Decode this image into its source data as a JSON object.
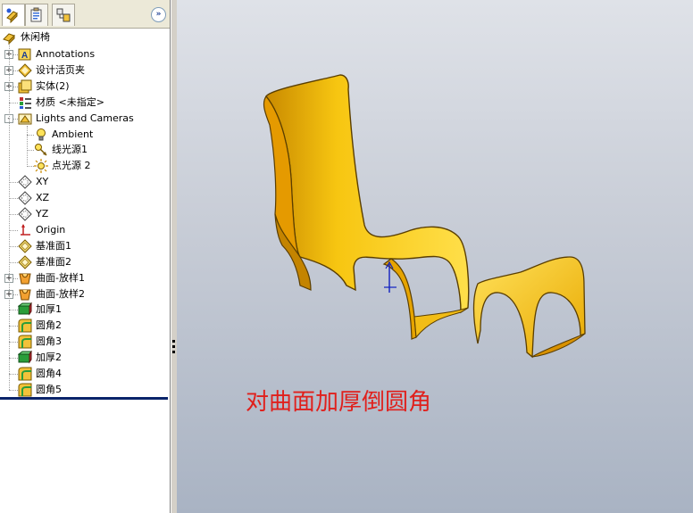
{
  "feature_tree": {
    "tabs": [
      {
        "icon": "feature-manager-icon"
      },
      {
        "icon": "property-manager-icon"
      },
      {
        "icon": "configuration-manager-icon"
      }
    ],
    "expand_symbol": "»",
    "root": {
      "label": "休闲椅",
      "icon": "part-icon"
    },
    "items": [
      {
        "label": "Annotations",
        "icon": "annotations-icon",
        "expander": "+"
      },
      {
        "label": "设计活页夹",
        "icon": "design-binder-icon",
        "expander": "+"
      },
      {
        "label": "实体(2)",
        "icon": "solid-bodies-icon",
        "expander": "+"
      },
      {
        "label": "材质 <未指定>",
        "icon": "material-icon",
        "expander": ""
      },
      {
        "label": "Lights and Cameras",
        "icon": "lights-icon",
        "expander": "-"
      },
      {
        "label": "Ambient",
        "icon": "ambient-light-icon",
        "expander": "",
        "child": true
      },
      {
        "label": "线光源1",
        "icon": "directional-light-icon",
        "expander": "",
        "child": true
      },
      {
        "label": "点光源 2",
        "icon": "point-light-icon",
        "expander": "",
        "child": true
      },
      {
        "label": "XY",
        "icon": "plane-icon",
        "expander": ""
      },
      {
        "label": "XZ",
        "icon": "plane-icon",
        "expander": ""
      },
      {
        "label": "YZ",
        "icon": "plane-icon",
        "expander": ""
      },
      {
        "label": "Origin",
        "icon": "origin-icon",
        "expander": ""
      },
      {
        "label": "基准面1",
        "icon": "ref-plane-icon",
        "expander": ""
      },
      {
        "label": "基准面2",
        "icon": "ref-plane-icon",
        "expander": ""
      },
      {
        "label": "曲面-放样1",
        "icon": "surface-loft-icon",
        "expander": "+"
      },
      {
        "label": "曲面-放样2",
        "icon": "surface-loft-icon",
        "expander": "+"
      },
      {
        "label": "加厚1",
        "icon": "thicken-icon",
        "expander": ""
      },
      {
        "label": "圆角2",
        "icon": "fillet-icon",
        "expander": ""
      },
      {
        "label": "圆角3",
        "icon": "fillet-icon",
        "expander": ""
      },
      {
        "label": "加厚2",
        "icon": "thicken-icon",
        "expander": ""
      },
      {
        "label": "圆角4",
        "icon": "fillet-icon",
        "expander": ""
      },
      {
        "label": "圆角5",
        "icon": "fillet-icon",
        "expander": ""
      }
    ]
  },
  "viewport": {
    "caption": "对曲面加厚倒圆角",
    "caption_color": "#e0201c",
    "model_color": "#f7c611"
  }
}
